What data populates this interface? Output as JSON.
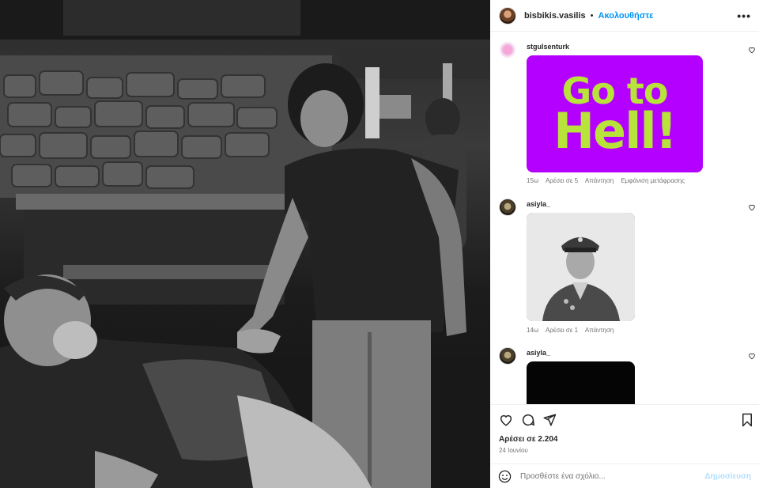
{
  "post": {
    "username": "bisbikis.vasilis",
    "separator": "•",
    "follow_label": "Ακολουθήστε",
    "more_icon": "more-horizontal-icon",
    "likes_text": "Αρέσει σε 2.204",
    "date_text": "24 Ιουνίου"
  },
  "comments": [
    {
      "username": "stgulsenturk",
      "media": {
        "type": "gif",
        "line1": "Go to",
        "line2": "Hell!",
        "background": "#b300ff",
        "text_color": "#b7e33a"
      },
      "time": "15ω",
      "likes": "Αρέσει σε 5",
      "reply": "Απάντηση",
      "translate": "Εμφάνιση μετάφρασης"
    },
    {
      "username": "asiyla_",
      "media": {
        "type": "photo",
        "subject": "military-portrait"
      },
      "time": "14ω",
      "likes": "Αρέσει σε 1",
      "reply": "Απάντηση"
    },
    {
      "username": "asiyla_",
      "media": {
        "type": "photo",
        "subject": "dark-image"
      }
    }
  ],
  "add_comment": {
    "placeholder": "Προσθέστε ένα σχόλιο...",
    "post_label": "Δημοσίευση"
  },
  "colors": {
    "accent": "#0095f6",
    "post_disabled": "#b2dffc",
    "muted_text": "#737373"
  }
}
